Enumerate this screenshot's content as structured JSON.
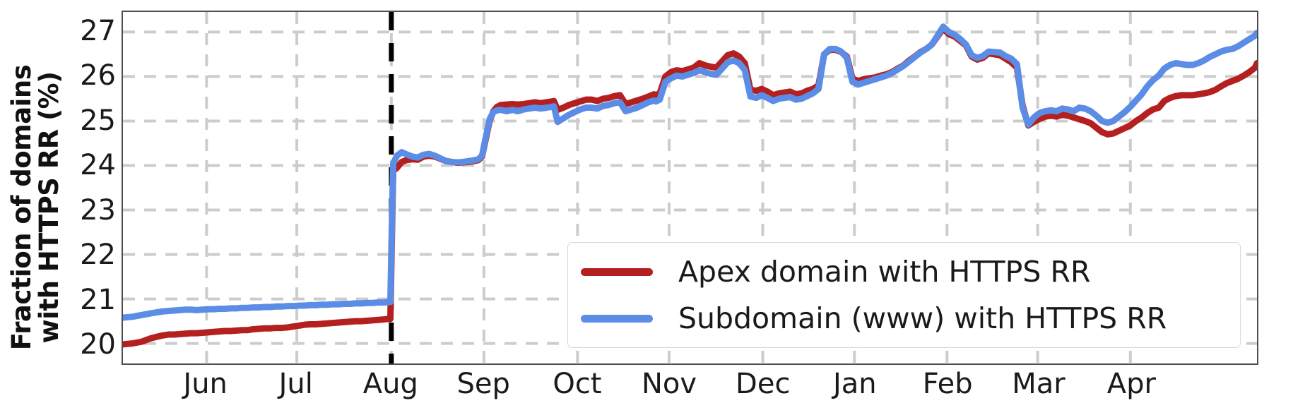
{
  "chart_data": {
    "type": "line",
    "title": "",
    "xlabel": "",
    "ylabel": "Fraction of domains with HTTPS RR (%)",
    "ylabel_line1": "Fraction of domains",
    "ylabel_line2": "with HTTPS RR (%)",
    "ylim": [
      19.55,
      27.45
    ],
    "yticks": [
      20,
      21,
      22,
      23,
      24,
      25,
      26,
      27
    ],
    "ytick_labels": [
      "20",
      "21",
      "22",
      "23",
      "24",
      "25",
      "26",
      "27"
    ],
    "xlim": [
      0,
      12
    ],
    "xticks": [
      1.0,
      2.0,
      3.0,
      4.0,
      5.0,
      6.0,
      7.0,
      8.0,
      9.0,
      10.0,
      11.0,
      12.0
    ],
    "xtick_labels": [
      "Jun",
      "Jul",
      "Aug",
      "Sep",
      "Oct",
      "Nov",
      "Dec",
      "Jan",
      "Feb",
      "Mar",
      "Apr"
    ],
    "xtick_positions": [
      0.885,
      1.84,
      2.84,
      3.82,
      4.81,
      5.78,
      6.77,
      7.74,
      8.72,
      9.68,
      10.66
    ],
    "grid": true,
    "grid_style": "dashed",
    "grid_color": "#cccccc",
    "legend_position": "lower right",
    "annotations": [
      {
        "name": "aug-vertical-line",
        "type": "vline",
        "x": 2.84,
        "style": "dashed",
        "color": "#000000",
        "width": 7
      }
    ],
    "series": [
      {
        "name": "Apex domain with HTTPS RR",
        "color": "#b41f1f",
        "linewidth": 9,
        "x": [
          0.0,
          0.05,
          0.1,
          0.15,
          0.2,
          0.25,
          0.3,
          0.36,
          0.42,
          0.48,
          0.54,
          0.6,
          0.66,
          0.72,
          0.78,
          0.84,
          0.9,
          0.96,
          1.02,
          1.08,
          1.14,
          1.2,
          1.26,
          1.32,
          1.38,
          1.44,
          1.5,
          1.56,
          1.62,
          1.68,
          1.74,
          1.8,
          1.86,
          1.92,
          1.98,
          2.04,
          2.1,
          2.16,
          2.22,
          2.28,
          2.34,
          2.4,
          2.46,
          2.52,
          2.58,
          2.64,
          2.7,
          2.76,
          2.8,
          2.83,
          2.845,
          2.86,
          2.9,
          2.95,
          3.0,
          3.06,
          3.12,
          3.18,
          3.24,
          3.3,
          3.36,
          3.42,
          3.48,
          3.54,
          3.6,
          3.66,
          3.72,
          3.76,
          3.8,
          3.84,
          3.88,
          3.92,
          3.96,
          4.0,
          4.06,
          4.12,
          4.18,
          4.24,
          4.3,
          4.36,
          4.42,
          4.48,
          4.54,
          4.56,
          4.6,
          4.66,
          4.72,
          4.78,
          4.84,
          4.9,
          4.96,
          5.02,
          5.08,
          5.14,
          5.2,
          5.26,
          5.32,
          5.38,
          5.44,
          5.5,
          5.56,
          5.62,
          5.64,
          5.68,
          5.74,
          5.8,
          5.86,
          5.92,
          5.98,
          6.04,
          6.1,
          6.16,
          6.22,
          6.28,
          6.34,
          6.4,
          6.46,
          6.52,
          6.58,
          6.64,
          6.7,
          6.76,
          6.82,
          6.88,
          6.94,
          7.0,
          7.06,
          7.12,
          7.18,
          7.24,
          7.3,
          7.36,
          7.42,
          7.48,
          7.54,
          7.6,
          7.66,
          7.72,
          7.78,
          7.84,
          7.9,
          7.96,
          8.02,
          8.08,
          8.14,
          8.2,
          8.26,
          8.32,
          8.38,
          8.44,
          8.5,
          8.56,
          8.62,
          8.68,
          8.74,
          8.8,
          8.86,
          8.92,
          8.98,
          9.04,
          9.1,
          9.16,
          9.22,
          9.28,
          9.34,
          9.4,
          9.46,
          9.52,
          9.58,
          9.64,
          9.7,
          9.76,
          9.82,
          9.88,
          9.94,
          10.0,
          10.06,
          10.12,
          10.18,
          10.24,
          10.3,
          10.36,
          10.42,
          10.48,
          10.54,
          10.6,
          10.66,
          10.72,
          10.78,
          10.84,
          10.9,
          10.96,
          11.02,
          11.08,
          11.14,
          11.2,
          11.26,
          11.32,
          11.38,
          11.44,
          11.5,
          11.56,
          11.62,
          11.68,
          11.74,
          11.8,
          11.86,
          11.92,
          11.98,
          12.0
        ],
        "y": [
          19.98,
          19.99,
          20.0,
          20.02,
          20.04,
          20.08,
          20.12,
          20.15,
          20.18,
          20.2,
          20.2,
          20.21,
          20.22,
          20.23,
          20.23,
          20.24,
          20.25,
          20.26,
          20.27,
          20.28,
          20.28,
          20.29,
          20.3,
          20.3,
          20.32,
          20.33,
          20.34,
          20.34,
          20.35,
          20.35,
          20.36,
          20.38,
          20.4,
          20.42,
          20.43,
          20.43,
          20.44,
          20.45,
          20.46,
          20.47,
          20.48,
          20.49,
          20.5,
          20.5,
          20.51,
          20.52,
          20.53,
          20.54,
          20.55,
          20.55,
          22.3,
          23.88,
          23.95,
          24.08,
          24.12,
          24.14,
          24.13,
          24.2,
          24.22,
          24.2,
          24.15,
          24.1,
          24.08,
          24.06,
          24.07,
          24.08,
          24.1,
          24.12,
          24.2,
          24.6,
          25.0,
          25.22,
          25.32,
          25.36,
          25.37,
          25.38,
          25.37,
          25.38,
          25.4,
          25.42,
          25.4,
          25.42,
          25.44,
          25.45,
          25.25,
          25.3,
          25.36,
          25.4,
          25.44,
          25.48,
          25.48,
          25.45,
          25.5,
          25.52,
          25.56,
          25.58,
          25.38,
          25.42,
          25.46,
          25.5,
          25.55,
          25.6,
          25.58,
          25.62,
          26.0,
          26.1,
          26.14,
          26.12,
          26.16,
          26.2,
          26.3,
          26.25,
          26.22,
          26.2,
          26.34,
          26.48,
          26.52,
          26.45,
          26.3,
          25.7,
          25.68,
          25.72,
          25.66,
          25.58,
          25.62,
          25.64,
          25.66,
          25.6,
          25.62,
          25.68,
          25.72,
          25.8,
          26.5,
          26.6,
          26.6,
          26.55,
          26.45,
          25.95,
          25.9,
          25.94,
          25.96,
          25.98,
          26.02,
          26.05,
          26.1,
          26.18,
          26.25,
          26.36,
          26.45,
          26.55,
          26.62,
          26.72,
          26.9,
          27.08,
          26.95,
          26.9,
          26.8,
          26.7,
          26.45,
          26.38,
          26.42,
          26.52,
          26.5,
          26.48,
          26.4,
          26.32,
          26.2,
          25.35,
          24.9,
          24.98,
          25.05,
          25.1,
          25.12,
          25.1,
          25.14,
          25.12,
          25.08,
          25.04,
          25.0,
          24.95,
          24.85,
          24.75,
          24.7,
          24.72,
          24.78,
          24.84,
          24.9,
          25.0,
          25.08,
          25.18,
          25.26,
          25.3,
          25.45,
          25.52,
          25.56,
          25.58,
          25.58,
          25.58,
          25.6,
          25.62,
          25.65,
          25.7,
          25.78,
          25.85,
          25.9,
          25.95,
          26.02,
          26.1,
          26.2,
          26.3
        ]
      },
      {
        "name": "Subdomain (www) with HTTPS RR",
        "color": "#5b8de6",
        "linewidth": 9,
        "x": [
          0.0,
          0.05,
          0.1,
          0.15,
          0.2,
          0.25,
          0.3,
          0.36,
          0.42,
          0.48,
          0.54,
          0.6,
          0.66,
          0.72,
          0.78,
          0.84,
          0.9,
          0.96,
          1.02,
          1.08,
          1.14,
          1.2,
          1.26,
          1.32,
          1.38,
          1.44,
          1.5,
          1.56,
          1.62,
          1.68,
          1.74,
          1.8,
          1.86,
          1.92,
          1.98,
          2.04,
          2.1,
          2.16,
          2.22,
          2.28,
          2.34,
          2.4,
          2.46,
          2.52,
          2.58,
          2.64,
          2.7,
          2.76,
          2.8,
          2.83,
          2.845,
          2.86,
          2.9,
          2.95,
          3.0,
          3.06,
          3.12,
          3.18,
          3.24,
          3.3,
          3.36,
          3.42,
          3.48,
          3.54,
          3.6,
          3.66,
          3.72,
          3.76,
          3.8,
          3.84,
          3.88,
          3.92,
          3.96,
          4.0,
          4.06,
          4.12,
          4.18,
          4.24,
          4.3,
          4.36,
          4.42,
          4.48,
          4.54,
          4.56,
          4.6,
          4.66,
          4.72,
          4.78,
          4.84,
          4.9,
          4.96,
          5.02,
          5.08,
          5.14,
          5.2,
          5.26,
          5.32,
          5.38,
          5.44,
          5.5,
          5.56,
          5.62,
          5.64,
          5.68,
          5.74,
          5.8,
          5.86,
          5.92,
          5.98,
          6.04,
          6.1,
          6.16,
          6.22,
          6.28,
          6.34,
          6.4,
          6.46,
          6.52,
          6.58,
          6.64,
          6.7,
          6.76,
          6.82,
          6.88,
          6.94,
          7.0,
          7.06,
          7.12,
          7.18,
          7.24,
          7.3,
          7.36,
          7.42,
          7.48,
          7.54,
          7.6,
          7.66,
          7.72,
          7.78,
          7.84,
          7.9,
          7.96,
          8.02,
          8.08,
          8.14,
          8.2,
          8.26,
          8.32,
          8.38,
          8.44,
          8.5,
          8.56,
          8.62,
          8.68,
          8.74,
          8.8,
          8.86,
          8.92,
          8.98,
          9.04,
          9.1,
          9.16,
          9.22,
          9.28,
          9.34,
          9.4,
          9.46,
          9.52,
          9.58,
          9.64,
          9.7,
          9.76,
          9.82,
          9.88,
          9.94,
          10.0,
          10.06,
          10.12,
          10.18,
          10.24,
          10.3,
          10.36,
          10.42,
          10.48,
          10.54,
          10.6,
          10.66,
          10.72,
          10.78,
          10.84,
          10.9,
          10.96,
          11.02,
          11.08,
          11.14,
          11.2,
          11.26,
          11.32,
          11.38,
          11.44,
          11.5,
          11.56,
          11.62,
          11.68,
          11.74,
          11.8,
          11.86,
          11.92,
          11.98,
          12.0
        ],
        "y": [
          20.58,
          20.59,
          20.6,
          20.62,
          20.64,
          20.66,
          20.68,
          20.7,
          20.72,
          20.73,
          20.74,
          20.75,
          20.76,
          20.76,
          20.75,
          20.76,
          20.77,
          20.77,
          20.78,
          20.78,
          20.79,
          20.79,
          20.8,
          20.8,
          20.81,
          20.81,
          20.82,
          20.82,
          20.83,
          20.83,
          20.84,
          20.84,
          20.85,
          20.85,
          20.86,
          20.86,
          20.87,
          20.87,
          20.88,
          20.88,
          20.89,
          20.89,
          20.9,
          20.9,
          20.91,
          20.91,
          20.92,
          20.92,
          20.93,
          20.93,
          22.6,
          24.05,
          24.22,
          24.3,
          24.25,
          24.2,
          24.18,
          24.24,
          24.26,
          24.22,
          24.16,
          24.1,
          24.08,
          24.07,
          24.08,
          24.1,
          24.12,
          24.14,
          24.22,
          24.64,
          25.04,
          25.2,
          25.24,
          25.25,
          25.22,
          25.25,
          25.22,
          25.26,
          25.28,
          25.3,
          25.28,
          25.3,
          25.32,
          25.33,
          24.98,
          25.06,
          25.14,
          25.2,
          25.26,
          25.3,
          25.3,
          25.28,
          25.34,
          25.36,
          25.4,
          25.42,
          25.22,
          25.26,
          25.3,
          25.36,
          25.42,
          25.46,
          25.44,
          25.48,
          25.88,
          25.96,
          26.02,
          26.0,
          26.04,
          26.08,
          26.14,
          26.1,
          26.06,
          26.04,
          26.18,
          26.32,
          26.36,
          26.3,
          26.15,
          25.55,
          25.52,
          25.58,
          25.52,
          25.45,
          25.5,
          25.52,
          25.54,
          25.48,
          25.5,
          25.56,
          25.62,
          25.72,
          26.5,
          26.62,
          26.62,
          26.56,
          26.42,
          25.88,
          25.82,
          25.86,
          25.9,
          25.94,
          25.98,
          26.02,
          26.08,
          26.16,
          26.24,
          26.34,
          26.44,
          26.54,
          26.62,
          26.72,
          26.92,
          27.12,
          27.0,
          26.94,
          26.84,
          26.72,
          26.48,
          26.42,
          26.46,
          26.56,
          26.55,
          26.54,
          26.46,
          26.4,
          26.28,
          25.3,
          24.92,
          25.08,
          25.18,
          25.22,
          25.24,
          25.22,
          25.28,
          25.26,
          25.22,
          25.3,
          25.28,
          25.22,
          25.12,
          25.0,
          24.96,
          25.0,
          25.1,
          25.2,
          25.32,
          25.46,
          25.6,
          25.78,
          25.92,
          26.02,
          26.18,
          26.26,
          26.3,
          26.28,
          26.26,
          26.26,
          26.3,
          26.36,
          26.44,
          26.5,
          26.56,
          26.6,
          26.62,
          26.68,
          26.76,
          26.84,
          26.92,
          26.98
        ]
      }
    ]
  },
  "legend": {
    "items": [
      {
        "label": "Apex domain with HTTPS RR",
        "color": "#b41f1f"
      },
      {
        "label": "Subdomain (www) with HTTPS RR",
        "color": "#5b8de6"
      }
    ]
  }
}
